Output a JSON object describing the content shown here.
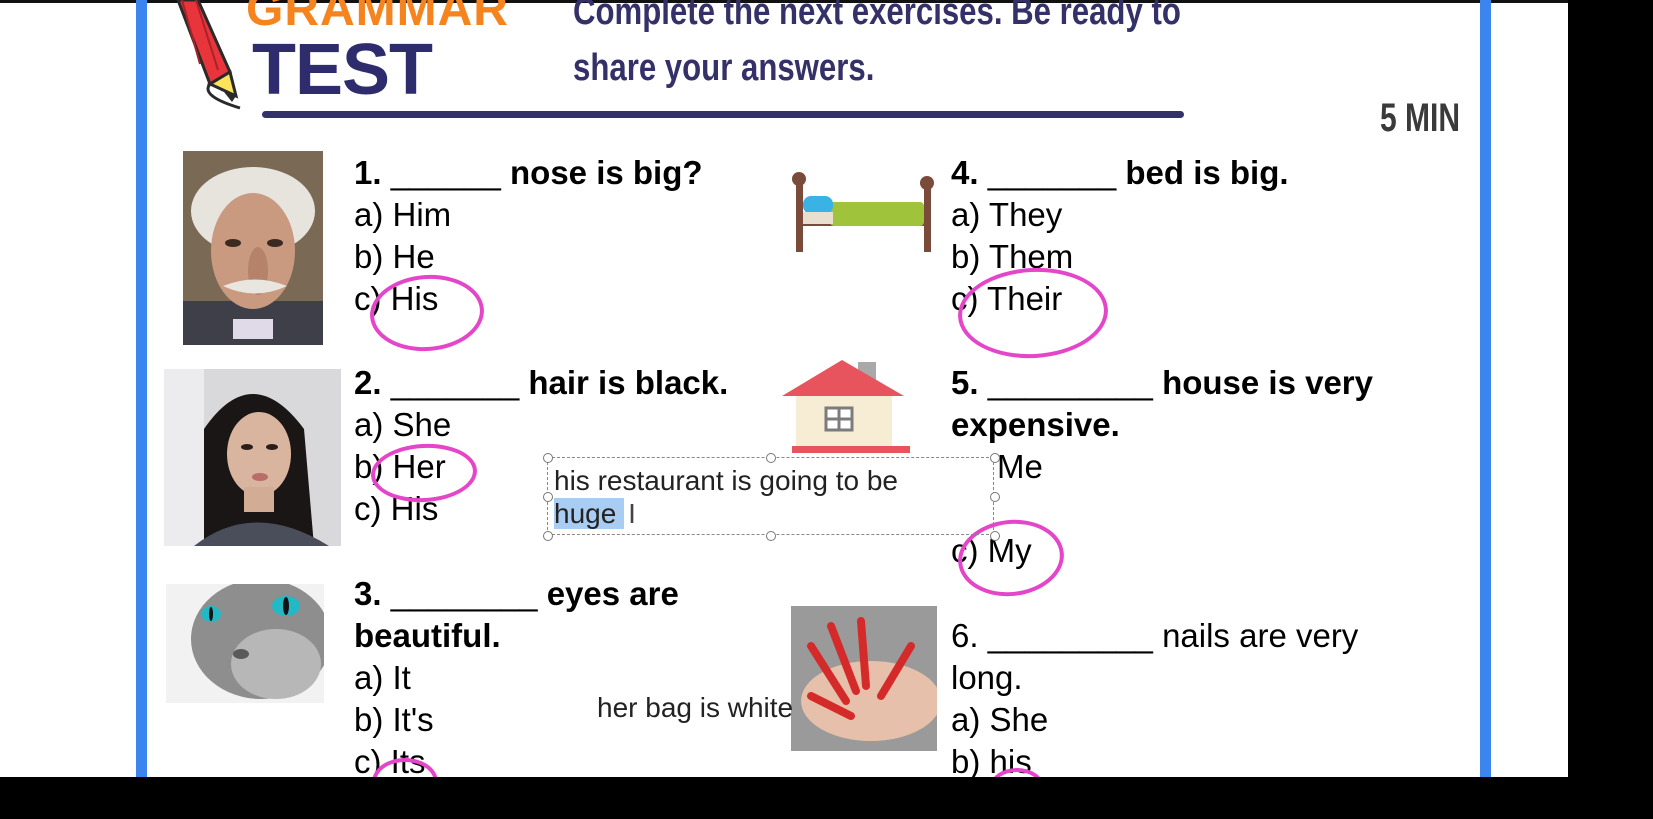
{
  "header": {
    "brand_top": "GRAMMAR",
    "brand_bottom": "TEST",
    "instructions": "Complete the next exercises. Be ready to share your answers.",
    "timer": "5 MIN"
  },
  "questions": [
    {
      "number": "1.",
      "blank": "______",
      "stem": "nose is big?",
      "options": [
        "a) Him",
        "b) He",
        "c) His"
      ]
    },
    {
      "number": "2.",
      "blank": "_______",
      "stem": "hair is black.",
      "options": [
        "a) She",
        "b) Her",
        "c) His"
      ]
    },
    {
      "number": "3.",
      "blank": "________",
      "stem": "eyes are",
      "stem2": "beautiful.",
      "options": [
        "a) It",
        "b) It's",
        "c) Its"
      ]
    },
    {
      "number": "4.",
      "blank": "_______",
      "stem": "bed is big.",
      "options": [
        "a) They",
        "b) Them",
        "c) Their"
      ]
    },
    {
      "number": "5.",
      "blank": "_________",
      "stem": "house is very",
      "stem2": "expensive.",
      "options": [
        "Me",
        "c) My"
      ]
    },
    {
      "number": "6.",
      "blank": "_________",
      "stem": "nails are very",
      "stem2": "long.",
      "options": [
        "a) She",
        "b) his"
      ]
    }
  ],
  "textbox": {
    "line1": "his restaurant is going to be",
    "selected": "huge "
  },
  "floating_text": "her bag is white",
  "colors": {
    "accent_orange": "#f5841f",
    "navy": "#343168",
    "border_blue": "#3b86ee",
    "circle_pink": "#e445c9"
  }
}
